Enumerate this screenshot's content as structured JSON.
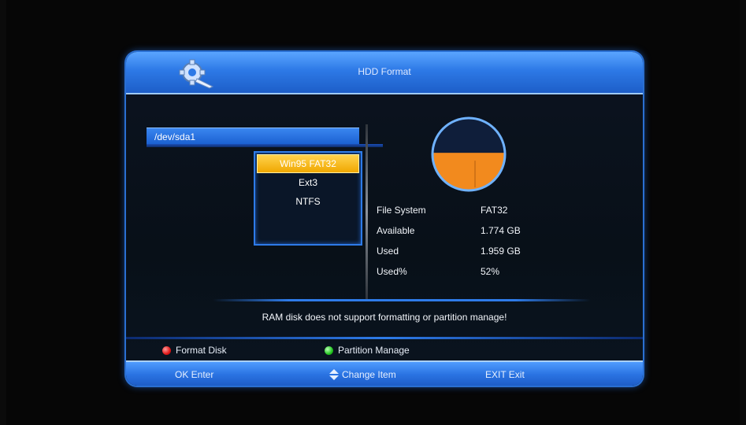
{
  "window": {
    "title": "HDD Format"
  },
  "device": {
    "name": "/dev/sda1"
  },
  "filesystem_menu": {
    "options": [
      "Win95 FAT32",
      "Ext3",
      "NTFS"
    ],
    "selected": "Win95 FAT32"
  },
  "disk_info": {
    "rows": [
      {
        "key": "File System",
        "value": "FAT32"
      },
      {
        "key": "Available",
        "value": "1.774 GB"
      },
      {
        "key": "Used",
        "value": "1.959 GB"
      },
      {
        "key": "Used%",
        "value": "52%"
      }
    ]
  },
  "usage_chart": {
    "used_fraction": 0.52,
    "used_color": "#f28a1e",
    "free_color": "#0f4aa8"
  },
  "notice": "RAM disk does not support formatting or partition manage!",
  "hints": {
    "red": {
      "label": "Format Disk",
      "icon": "red-dot-icon"
    },
    "green": {
      "label": "Partition Manage",
      "icon": "green-dot-icon"
    }
  },
  "footer": {
    "ok": "OK Enter",
    "change": "Change Item",
    "exit": "EXIT Exit"
  },
  "colors": {
    "accent": "#2e7be8",
    "highlight": "#f0a800"
  }
}
